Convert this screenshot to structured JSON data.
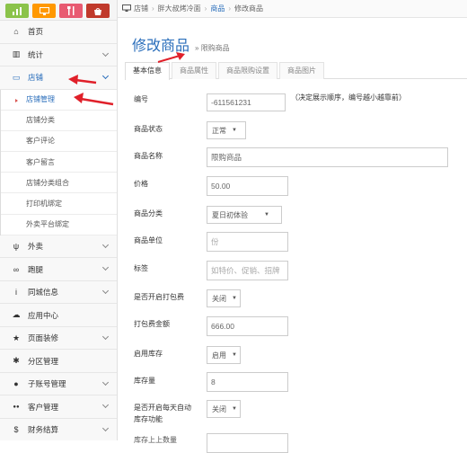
{
  "quickbar": {
    "colors": [
      "#8bc34a",
      "#ff9800",
      "#e85a71",
      "#c0392b"
    ],
    "icons": [
      "chart-icon",
      "monitor-icon",
      "cutlery-icon",
      "shop-icon"
    ]
  },
  "sidebar": {
    "items_top": [
      {
        "label": "首页",
        "icon": "home-icon",
        "glyph": "⌂",
        "chevron": false
      },
      {
        "label": "统计",
        "icon": "bar-chart-icon",
        "glyph": "▥",
        "chevron": true
      }
    ],
    "store": {
      "label": "店铺",
      "icon": "monitor-icon",
      "glyph": "▭"
    },
    "store_sub": [
      "店铺管理",
      "店铺分类",
      "客户评论",
      "客户留言",
      "店铺分类组合",
      "打印机绑定",
      "外卖平台绑定"
    ],
    "items_bottom": [
      {
        "label": "外卖",
        "icon": "cutlery-icon",
        "glyph": "ψ",
        "chevron": true
      },
      {
        "label": "跑腿",
        "icon": "bicycle-icon",
        "glyph": "∞",
        "chevron": true
      },
      {
        "label": "同城信息",
        "icon": "info-icon",
        "glyph": "i",
        "chevron": true
      },
      {
        "label": "应用中心",
        "icon": "cloud-icon",
        "glyph": "☁",
        "chevron": false
      },
      {
        "label": "页面装修",
        "icon": "star-icon",
        "glyph": "★",
        "chevron": true
      },
      {
        "label": "分区管理",
        "icon": "gear-icon",
        "glyph": "✱",
        "chevron": false
      },
      {
        "label": "子账号管理",
        "icon": "user-icon",
        "glyph": "●",
        "chevron": true
      },
      {
        "label": "客户管理",
        "icon": "users-icon",
        "glyph": "●●",
        "chevron": true
      },
      {
        "label": "财务结算",
        "icon": "dollar-icon",
        "glyph": "$",
        "chevron": true
      }
    ]
  },
  "breadcrumb": {
    "home": "店铺",
    "shop": "胖大叔烤冷面",
    "goods": "商品",
    "current": "修改商品"
  },
  "header": {
    "title": "修改商品",
    "subtitle": "» 限购商品"
  },
  "tabs": [
    "基本信息",
    "商品属性",
    "商品限购设置",
    "商品图片"
  ],
  "form": {
    "number_label": "编号",
    "number_value": "-611561231",
    "number_hint": "（决定展示顺序，编号越小越靠前）",
    "status_label": "商品状态",
    "status_value": "正常",
    "name_label": "商品名称",
    "name_value": "限购商品",
    "price_label": "价格",
    "price_value": "50.00",
    "category_label": "商品分类",
    "category_value": "夏日初体验",
    "unit_label": "商品单位",
    "unit_placeholder": "份",
    "tags_label": "标签",
    "tags_placeholder": "如特价、促销、招牌",
    "pack_label": "是否开启打包费",
    "pack_value": "关闭",
    "packfee_label": "打包费金额",
    "packfee_value": "666.00",
    "stock_label": "启用库存",
    "stock_value": "启用",
    "stockqty_label": "库存量",
    "stockqty_value": "8",
    "daily_label_1": "是否开启每天自动",
    "daily_label_2": "库存功能",
    "daily_value": "关闭",
    "last_label": "库存上上数量"
  },
  "accent": "#2a6ebb",
  "annotation_color": "#e0202a"
}
